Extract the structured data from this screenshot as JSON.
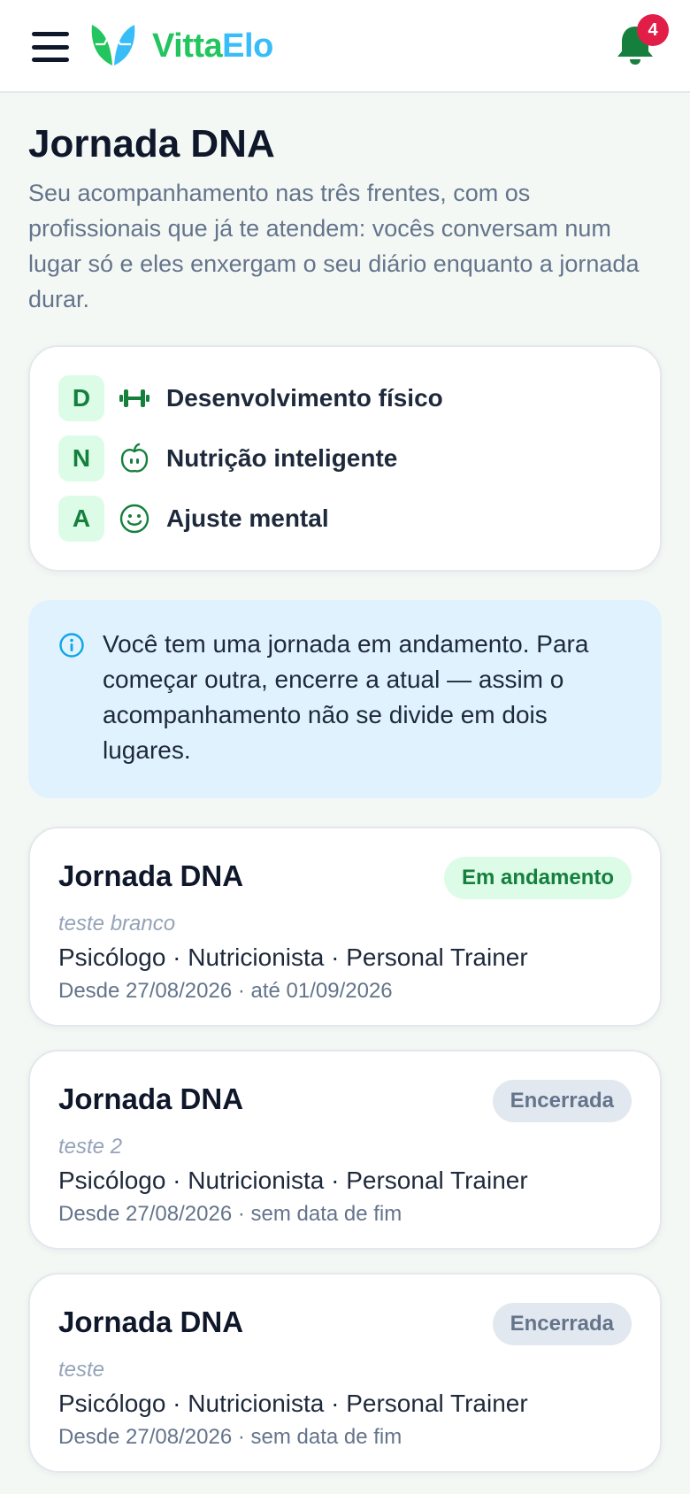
{
  "header": {
    "brand_part1": "Vitta",
    "brand_part2": "Elo",
    "notification_count": "4",
    "colors": {
      "brand_green": "#22c55e",
      "brand_blue": "#38bdf8",
      "badge": "#e11d48",
      "accent": "#15803d"
    }
  },
  "page": {
    "title": "Jornada DNA",
    "subtitle": "Seu acompanhamento nas três frentes, com os profissionais que já te atendem: vocês conversam num lugar só e eles enxergam o seu diário enquanto a jornada durar."
  },
  "pillars": [
    {
      "letter": "D",
      "icon": "dumbbell-icon",
      "label": "Desenvolvimento físico"
    },
    {
      "letter": "N",
      "icon": "apple-icon",
      "label": "Nutrição inteligente"
    },
    {
      "letter": "A",
      "icon": "smile-icon",
      "label": "Ajuste mental"
    }
  ],
  "info": {
    "icon": "info-icon",
    "text": "Você tem uma jornada em andamento. Para começar outra, encerre a atual — assim o acompanhamento não se divide em dois lugares."
  },
  "journeys": [
    {
      "title": "Jornada DNA",
      "status": "Em andamento",
      "note": "teste branco",
      "roles": "Psicólogo · Nutricionista · Personal Trainer",
      "dates": "Desde 27/08/2026 · até 01/09/2026"
    },
    {
      "title": "Jornada DNA",
      "status": "Encerrada",
      "note": "teste 2",
      "roles": "Psicólogo · Nutricionista · Personal Trainer",
      "dates": "Desde 27/08/2026 · sem data de fim"
    },
    {
      "title": "Jornada DNA",
      "status": "Encerrada",
      "note": "teste",
      "roles": "Psicólogo · Nutricionista · Personal Trainer",
      "dates": "Desde 27/08/2026 · sem data de fim"
    }
  ]
}
